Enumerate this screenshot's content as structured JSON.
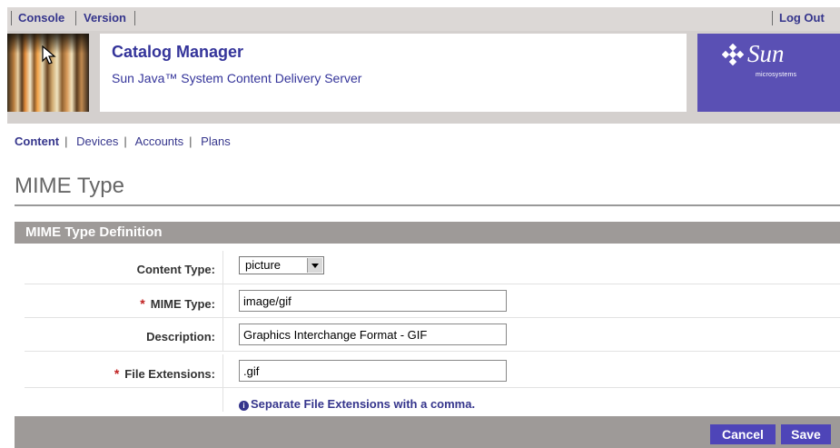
{
  "topbar": {
    "console": "Console",
    "version": "Version",
    "logout": "Log Out"
  },
  "banner": {
    "title": "Catalog Manager",
    "subtitle": "Sun Java™ System Content Delivery Server",
    "logo_word": "Sun",
    "logo_small": "microsystems"
  },
  "nav": {
    "items": [
      "Content",
      "Devices",
      "Accounts",
      "Plans"
    ],
    "active": "Content"
  },
  "page": {
    "title": "MIME Type"
  },
  "section": {
    "title": "MIME Type Definition"
  },
  "form": {
    "content_type": {
      "label": "Content Type:",
      "value": "picture",
      "required": false
    },
    "mime_type": {
      "label": "MIME Type:",
      "value": "image/gif",
      "required": true
    },
    "description": {
      "label": "Description:",
      "value": "Graphics Interchange Format - GIF",
      "required": false
    },
    "file_extensions": {
      "label": "File Extensions:",
      "value": ".gif",
      "required": true
    },
    "required_mark": "*",
    "hint": "Separate File Extensions with a comma."
  },
  "buttons": {
    "cancel": "Cancel",
    "save": "Save"
  },
  "colors": {
    "accent": "#35358c",
    "logo_bg": "#5a50b4",
    "button_bg": "#4e45b8",
    "section_bg": "#9e9a98",
    "required": "#c02020"
  }
}
